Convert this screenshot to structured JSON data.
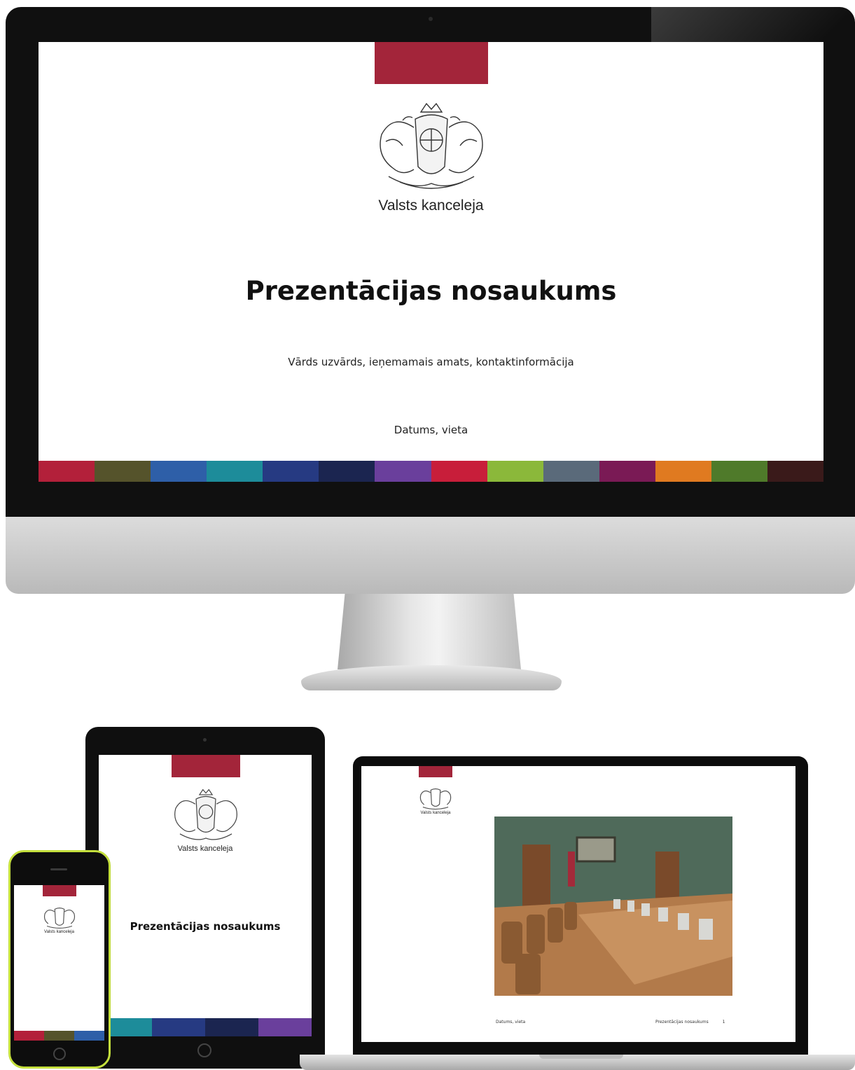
{
  "slide": {
    "organization": "Valsts kanceleja",
    "title": "Prezentācijas nosaukums",
    "subtitle": "Vārds uzvārds, ieņemamais amats, kontaktinformācija",
    "date_place": "Datums, vieta",
    "accent_color": "#a3253a",
    "stripe_colors": [
      "#b3203a",
      "#55532b",
      "#2e5fa8",
      "#1d8c9a",
      "#263a82",
      "#1b2550",
      "#6a3f9c",
      "#c81e3a",
      "#8bb83a",
      "#5a6a7a",
      "#7a1a55",
      "#e07a20",
      "#4f7a2a",
      "#3a1a1a"
    ]
  },
  "tablet": {
    "stripe_colors": [
      "#1d8c9a",
      "#263a82",
      "#1b2550",
      "#6a3f9c"
    ]
  },
  "phone": {
    "stripe_colors": [
      "#b3203a",
      "#55532b",
      "#2e5fa8"
    ]
  },
  "laptop": {
    "date_place": "Datums, vieta",
    "footer_text": "Prezentācijas nosaukums",
    "page_number": "1"
  },
  "icons": {
    "crest": "coat-of-arms-icon"
  }
}
